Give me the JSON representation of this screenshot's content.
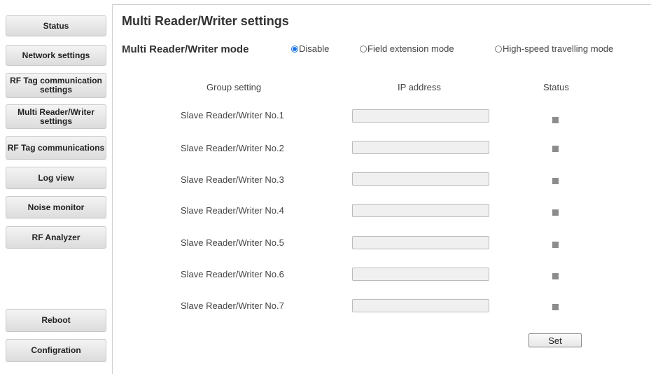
{
  "sidebar": {
    "items": [
      {
        "label": "Status"
      },
      {
        "label": "Network settings"
      },
      {
        "label": "RF Tag communication settings"
      },
      {
        "label": "Multi Reader/Writer settings"
      },
      {
        "label": "RF Tag communications"
      },
      {
        "label": "Log view"
      },
      {
        "label": "Noise monitor"
      },
      {
        "label": "RF Analyzer"
      },
      {
        "label": "Reboot"
      },
      {
        "label": "Configration"
      }
    ]
  },
  "main": {
    "title": "Multi Reader/Writer settings",
    "mode_label": "Multi Reader/Writer mode",
    "modes": [
      {
        "label": "Disable",
        "selected": true
      },
      {
        "label": "Field extension mode",
        "selected": false
      },
      {
        "label": "High-speed travelling mode",
        "selected": false
      }
    ],
    "columns": {
      "group": "Group setting",
      "ip": "IP address",
      "status": "Status"
    },
    "rows": [
      {
        "label": "Slave Reader/Writer No.1",
        "ip": ""
      },
      {
        "label": "Slave Reader/Writer No.2",
        "ip": ""
      },
      {
        "label": "Slave Reader/Writer No.3",
        "ip": ""
      },
      {
        "label": "Slave Reader/Writer No.4",
        "ip": ""
      },
      {
        "label": "Slave Reader/Writer No.5",
        "ip": ""
      },
      {
        "label": "Slave Reader/Writer No.6",
        "ip": ""
      },
      {
        "label": "Slave Reader/Writer No.7",
        "ip": ""
      }
    ],
    "set_label": "Set",
    "status_color": "#8c8c8c",
    "accent_color": "#1a73e8"
  }
}
